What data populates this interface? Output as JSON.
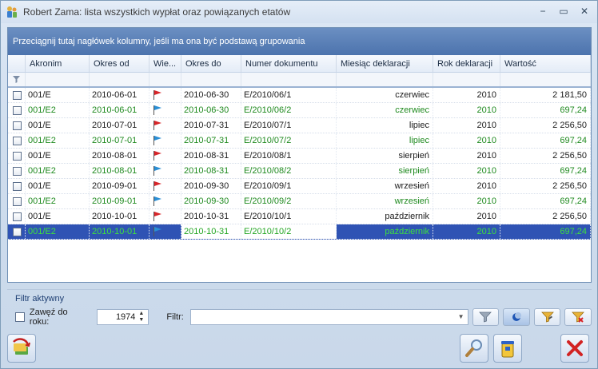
{
  "window": {
    "title": "Robert Zama: lista wszystkich wypłat oraz powiązanych etatów",
    "controls": {
      "minimize": "−",
      "maximize": "▭",
      "close": "✕"
    }
  },
  "grid": {
    "group_hint": "Przeciągnij tutaj nagłówek kolumny, jeśli ma ona być podstawą grupowania",
    "columns": [
      "Akronim",
      "Okres od",
      "Wie...",
      "Okres do",
      "Numer dokumentu",
      "Miesiąc deklaracji",
      "Rok deklaracji",
      "Wartość"
    ],
    "filter_icon": "funnel-icon",
    "rows": [
      {
        "akronim": "001/E",
        "okres_od": "2010-06-01",
        "flag": "red",
        "okres_do": "2010-06-30",
        "numer": "E/2010/06/1",
        "miesiac": "czerwiec",
        "rok": "2010",
        "wartosc": "2 181,50",
        "green": false,
        "selected": false
      },
      {
        "akronim": "001/E2",
        "okres_od": "2010-06-01",
        "flag": "blue",
        "okres_do": "2010-06-30",
        "numer": "E/2010/06/2",
        "miesiac": "czerwiec",
        "rok": "2010",
        "wartosc": "697,24",
        "green": true,
        "selected": false
      },
      {
        "akronim": "001/E",
        "okres_od": "2010-07-01",
        "flag": "red",
        "okres_do": "2010-07-31",
        "numer": "E/2010/07/1",
        "miesiac": "lipiec",
        "rok": "2010",
        "wartosc": "2 256,50",
        "green": false,
        "selected": false
      },
      {
        "akronim": "001/E2",
        "okres_od": "2010-07-01",
        "flag": "blue",
        "okres_do": "2010-07-31",
        "numer": "E/2010/07/2",
        "miesiac": "lipiec",
        "rok": "2010",
        "wartosc": "697,24",
        "green": true,
        "selected": false
      },
      {
        "akronim": "001/E",
        "okres_od": "2010-08-01",
        "flag": "red",
        "okres_do": "2010-08-31",
        "numer": "E/2010/08/1",
        "miesiac": "sierpień",
        "rok": "2010",
        "wartosc": "2 256,50",
        "green": false,
        "selected": false
      },
      {
        "akronim": "001/E2",
        "okres_od": "2010-08-01",
        "flag": "blue",
        "okres_do": "2010-08-31",
        "numer": "E/2010/08/2",
        "miesiac": "sierpień",
        "rok": "2010",
        "wartosc": "697,24",
        "green": true,
        "selected": false
      },
      {
        "akronim": "001/E",
        "okres_od": "2010-09-01",
        "flag": "red",
        "okres_do": "2010-09-30",
        "numer": "E/2010/09/1",
        "miesiac": "wrzesień",
        "rok": "2010",
        "wartosc": "2 256,50",
        "green": false,
        "selected": false
      },
      {
        "akronim": "001/E2",
        "okres_od": "2010-09-01",
        "flag": "blue",
        "okres_do": "2010-09-30",
        "numer": "E/2010/09/2",
        "miesiac": "wrzesień",
        "rok": "2010",
        "wartosc": "697,24",
        "green": true,
        "selected": false
      },
      {
        "akronim": "001/E",
        "okres_od": "2010-10-01",
        "flag": "red",
        "okres_do": "2010-10-31",
        "numer": "E/2010/10/1",
        "miesiac": "październik",
        "rok": "2010",
        "wartosc": "2 256,50",
        "green": false,
        "selected": false
      },
      {
        "akronim": "001/E2",
        "okres_od": "2010-10-01",
        "flag": "blue",
        "okres_do": "2010-10-31",
        "numer": "E/2010/10/2",
        "miesiac": "październik",
        "rok": "2010",
        "wartosc": "697,24",
        "green": true,
        "selected": true
      }
    ]
  },
  "filter_panel": {
    "title": "Filtr aktywny",
    "year_label": "Zawęź do roku:",
    "year_value": "1974",
    "filter_label": "Filtr:",
    "filter_value": ""
  },
  "colors": {
    "selection": "#2f53b4",
    "green_text": "#1f8a1f",
    "group_bar": "#4c73ad"
  }
}
